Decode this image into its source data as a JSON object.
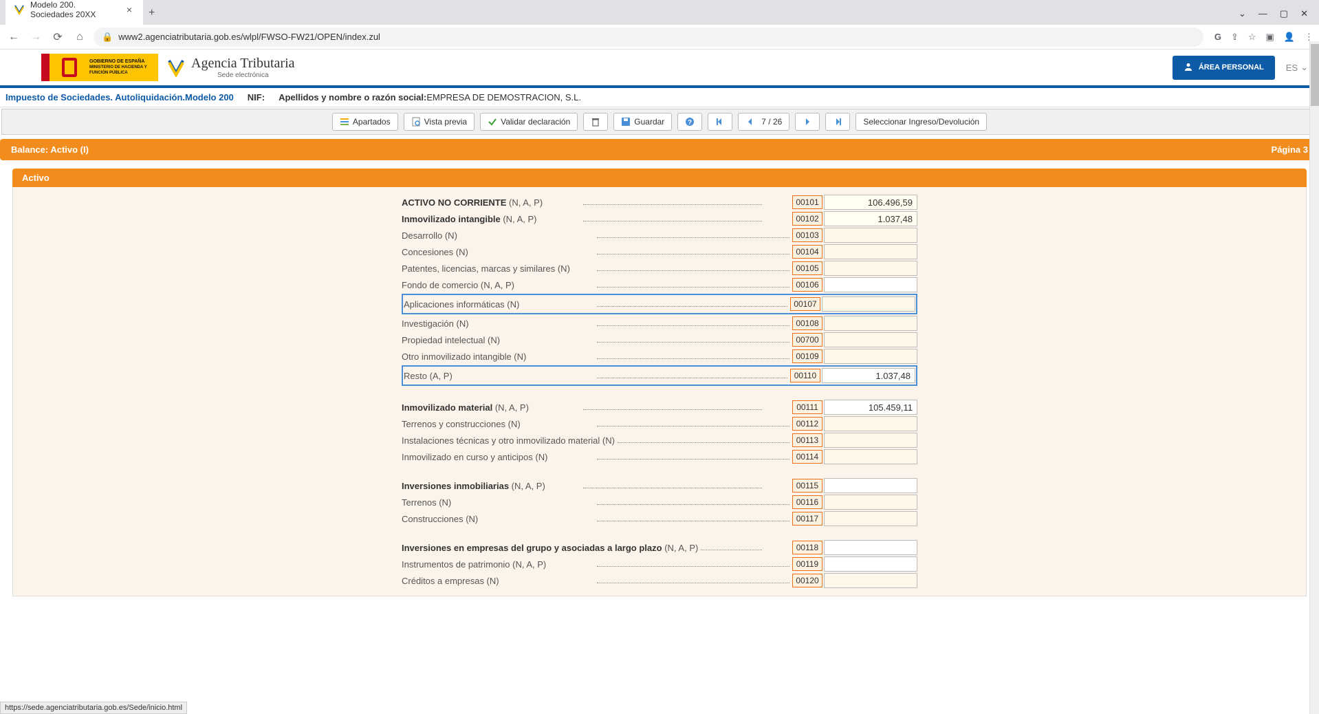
{
  "browser": {
    "tab_title": "Modelo 200. Sociedades 20XX",
    "url": "www2.agenciatributaria.gob.es/wlpl/FWSO-FW21/OPEN/index.zul",
    "status_bar": "https://sede.agenciatributaria.gob.es/Sede/inicio.html"
  },
  "header": {
    "flag_gov": "GOBIERNO DE ESPAÑA",
    "flag_min": "MINISTERIO DE HACIENDA Y FUNCIÓN PÚBLICA",
    "agency_name": "Agencia Tributaria",
    "agency_sub": "Sede electrónica",
    "personal_area": "ÁREA PERSONAL",
    "lang": "ES"
  },
  "page_title": {
    "main": "Impuesto de Sociedades. Autoliquidación.Modelo 200",
    "nif_label": "NIF:",
    "razon_label": "Apellidos y nombre o razón social:",
    "razon_value": "EMPRESA DE DEMOSTRACION, S.L."
  },
  "toolbar": {
    "apartados": "Apartados",
    "vista_previa": "Vista previa",
    "validar": "Validar declaración",
    "guardar": "Guardar",
    "page": "7 / 26",
    "select_ingreso": "Seleccionar Ingreso/Devolución"
  },
  "section": {
    "main_left": "Balance: Activo (I)",
    "main_right": "Página 3",
    "sub": "Activo"
  },
  "rows": [
    {
      "label_bold": "ACTIVO NO CORRIENTE",
      "suffix": " (N, A, P)",
      "code": "00101",
      "value": "106.496,59",
      "type": "total",
      "shift": true
    },
    {
      "label_bold": "Inmovilizado intangible",
      "suffix": " (N, A, P)",
      "code": "00102",
      "value": "1.037,48",
      "type": "total",
      "shift": true
    },
    {
      "label": "Desarrollo (N)",
      "code": "00103",
      "value": "",
      "type": "sub"
    },
    {
      "label": "Concesiones (N)",
      "code": "00104",
      "value": "",
      "type": "sub"
    },
    {
      "label": "Patentes, licencias, marcas y similares (N)",
      "code": "00105",
      "value": "",
      "type": "sub"
    },
    {
      "label": "Fondo de comercio (N, A, P)",
      "code": "00106",
      "value": "",
      "type": "sub",
      "white": true
    },
    {
      "label": "Aplicaciones informáticas (N)",
      "code": "00107",
      "value": "",
      "type": "sub",
      "highlight": true
    },
    {
      "label": "Investigación (N)",
      "code": "00108",
      "value": "",
      "type": "sub"
    },
    {
      "label": "Propiedad intelectual (N)",
      "code": "00700",
      "value": "",
      "type": "sub"
    },
    {
      "label": "Otro inmovilizado intangible (N)",
      "code": "00109",
      "value": "",
      "type": "sub"
    },
    {
      "label": "Resto (A, P)",
      "code": "00110",
      "value": "1.037,48",
      "type": "sub",
      "highlight": true,
      "white": true
    },
    {
      "spacer": true
    },
    {
      "label_bold": "Inmovilizado material",
      "suffix": " (N, A, P)",
      "code": "00111",
      "value": "105.459,11",
      "type": "total",
      "shift": true,
      "white": true
    },
    {
      "label": "Terrenos y construcciones (N)",
      "code": "00112",
      "value": "",
      "type": "sub"
    },
    {
      "label": "Instalaciones técnicas y otro inmovilizado material (N)",
      "code": "00113",
      "value": "",
      "type": "sub"
    },
    {
      "label": "Inmovilizado en curso y anticipos (N)",
      "code": "00114",
      "value": "",
      "type": "sub"
    },
    {
      "spacer": true
    },
    {
      "label_bold": "Inversiones inmobiliarias",
      "suffix": " (N, A, P)",
      "code": "00115",
      "value": "",
      "type": "total",
      "shift": true,
      "white": true
    },
    {
      "label": "Terrenos (N)",
      "code": "00116",
      "value": "",
      "type": "sub"
    },
    {
      "label": "Construcciones (N)",
      "code": "00117",
      "value": "",
      "type": "sub"
    },
    {
      "spacer": true
    },
    {
      "label_bold": "Inversiones en empresas del grupo y asociadas a largo plazo",
      "suffix": " (N, A, P)",
      "code": "00118",
      "value": "",
      "type": "total",
      "shift": true,
      "white": true
    },
    {
      "label": "Instrumentos de patrimonio (N, A, P)",
      "code": "00119",
      "value": "",
      "type": "sub",
      "white": true
    },
    {
      "label": "Créditos a empresas (N)",
      "code": "00120",
      "value": "",
      "type": "sub"
    }
  ]
}
